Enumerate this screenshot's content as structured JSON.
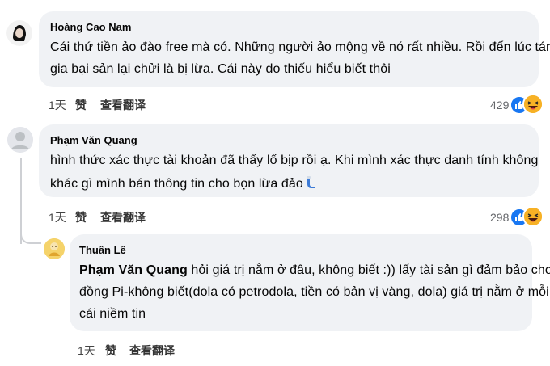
{
  "comments": [
    {
      "author": "Hoàng Cao Nam",
      "lines": [
        "Cái thứ tiền ảo đào free mà có. Những người ảo mộng về nó rất nhiều. Rồi đến lúc tán",
        "gia bại sản lại chửi là bị lừa. Cái này do thiếu hiểu biết thôi"
      ],
      "time": "1天",
      "like_label": "赞",
      "translate_label": "查看翻译",
      "reaction_count": "429",
      "reaction_icons": [
        "like-icon",
        "haha-icon"
      ]
    },
    {
      "author": "Phạm Văn Quang",
      "lines": [
        "hình thức xác thực tài khoản đã thấy lố bịp rồi ạ. Khi mình xác thực danh tính không",
        "khác gì mình bán thông tin cho bọn lừa đảo"
      ],
      "trailing_emoji": "smirk-emoji",
      "time": "1天",
      "like_label": "赞",
      "translate_label": "查看翻译",
      "reaction_count": "298",
      "reaction_icons": [
        "like-icon",
        "haha-icon"
      ]
    }
  ],
  "reply": {
    "author": "Thuân Lê",
    "mention": "Phạm Văn Quang",
    "line1_rest": " hỏi giá trị nằm ở đâu, không biết :)) lấy tài sản gì đảm bảo cho",
    "lines": [
      "đồng Pi-không biết(dola có petrodola, tiền có bản vị vàng, dola) giá trị nằm ở mỗi",
      "cái niềm tin"
    ],
    "time": "1天",
    "like_label": "赞",
    "translate_label": "查看翻译"
  },
  "colors": {
    "bubble": "#f0f2f5",
    "like": "#1877f2",
    "haha": "#f7b125",
    "thread_line": "#ced0d4"
  }
}
